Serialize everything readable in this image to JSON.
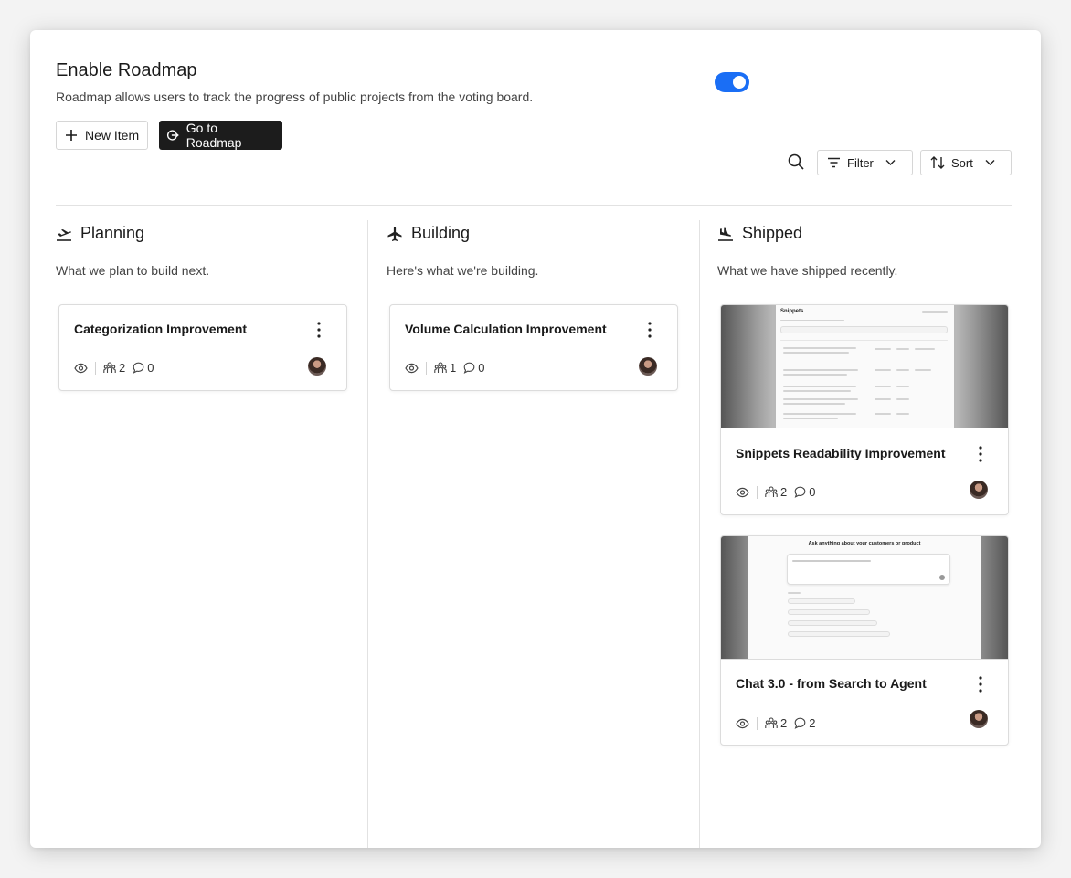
{
  "header": {
    "title": "Enable Roadmap",
    "description": "Roadmap allows users to track the progress of public projects from the voting board.",
    "toggle_on": true,
    "accent_color": "#1a6ef5"
  },
  "actions": {
    "new_item_label": "New Item",
    "go_roadmap_label": "Go to Roadmap"
  },
  "toolbar": {
    "filter_label": "Filter",
    "sort_label": "Sort"
  },
  "columns": [
    {
      "title": "Planning",
      "icon": "plane-departure-icon",
      "subtitle": "What we plan to build next.",
      "cards": [
        {
          "title": "Categorization Improvement",
          "voters": "2",
          "comments": "0",
          "has_image": false
        }
      ]
    },
    {
      "title": "Building",
      "icon": "plane-icon",
      "subtitle": "Here's what we're building.",
      "cards": [
        {
          "title": "Volume Calculation Improvement",
          "voters": "1",
          "comments": "0",
          "has_image": false
        }
      ]
    },
    {
      "title": "Shipped",
      "icon": "plane-arrival-icon",
      "subtitle": "What we have shipped recently.",
      "cards": [
        {
          "title": "Snippets Readability Improvement",
          "voters": "2",
          "comments": "0",
          "has_image": true
        },
        {
          "title": "Chat 3.0 - from Search to Agent",
          "voters": "2",
          "comments": "2",
          "has_image": true
        }
      ]
    }
  ],
  "thumbnails": {
    "snippets_heading": "Snippets",
    "chat_heading": "Ask anything about your customers or product"
  }
}
